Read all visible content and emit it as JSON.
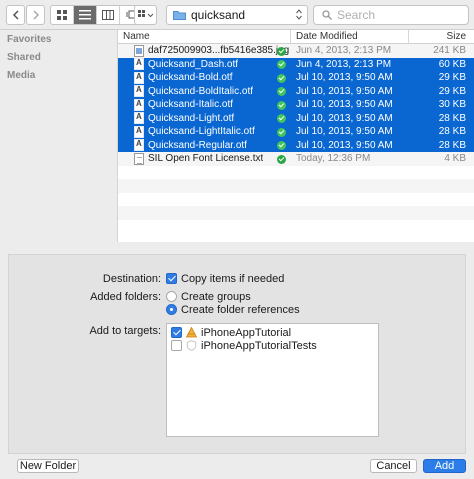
{
  "toolbar": {
    "back_icon": "chevron-left-icon",
    "forward_icon": "chevron-right-icon",
    "view_modes": [
      "icon-view",
      "list-view",
      "column-view",
      "coverflow-view"
    ],
    "arrange_icon": "arrange-grid-icon",
    "path_folder": "quicksand",
    "search_placeholder": "Search"
  },
  "sidebar": {
    "sections": [
      "Favorites",
      "Shared",
      "Media"
    ]
  },
  "file_list": {
    "columns": {
      "name": "Name",
      "date": "Date Modified",
      "size": "Size"
    },
    "rows": [
      {
        "name": "daf725009903...fb5416e385.jpg",
        "date": "Jun 4, 2013, 2:13 PM",
        "size": "241 KB",
        "selected": false,
        "icon": "image-file-icon",
        "checked": true
      },
      {
        "name": "Quicksand_Dash.otf",
        "date": "Jun 4, 2013, 2:13 PM",
        "size": "60 KB",
        "selected": true,
        "icon": "font-file-icon",
        "checked": true
      },
      {
        "name": "Quicksand-Bold.otf",
        "date": "Jul 10, 2013, 9:50 AM",
        "size": "29 KB",
        "selected": true,
        "icon": "font-file-icon",
        "checked": true
      },
      {
        "name": "Quicksand-BoldItalic.otf",
        "date": "Jul 10, 2013, 9:50 AM",
        "size": "29 KB",
        "selected": true,
        "icon": "font-file-icon",
        "checked": true
      },
      {
        "name": "Quicksand-Italic.otf",
        "date": "Jul 10, 2013, 9:50 AM",
        "size": "30 KB",
        "selected": true,
        "icon": "font-file-icon",
        "checked": true
      },
      {
        "name": "Quicksand-Light.otf",
        "date": "Jul 10, 2013, 9:50 AM",
        "size": "28 KB",
        "selected": true,
        "icon": "font-file-icon",
        "checked": true
      },
      {
        "name": "Quicksand-LightItalic.otf",
        "date": "Jul 10, 2013, 9:50 AM",
        "size": "28 KB",
        "selected": true,
        "icon": "font-file-icon",
        "checked": true
      },
      {
        "name": "Quicksand-Regular.otf",
        "date": "Jul 10, 2013, 9:50 AM",
        "size": "28 KB",
        "selected": true,
        "icon": "font-file-icon",
        "checked": true
      },
      {
        "name": "SIL Open Font License.txt",
        "date": "Today, 12:36 PM",
        "size": "4 KB",
        "selected": false,
        "icon": "text-file-icon",
        "checked": true
      }
    ]
  },
  "options": {
    "destination_label": "Destination:",
    "copy_items_label": "Copy items if needed",
    "copy_items_checked": true,
    "added_folders_label": "Added folders:",
    "create_groups_label": "Create groups",
    "create_folder_refs_label": "Create folder references",
    "selected_folder_option": "create_folder_references",
    "add_to_targets_label": "Add to targets:",
    "targets": [
      {
        "name": "iPhoneAppTutorial",
        "checked": true,
        "icon": "app-target-icon"
      },
      {
        "name": "iPhoneAppTutorialTests",
        "checked": false,
        "icon": "test-target-icon"
      }
    ]
  },
  "buttons": {
    "new_folder": "New Folder",
    "cancel": "Cancel",
    "add": "Add"
  },
  "colors": {
    "selection": "#0a67d2",
    "accent": "#2b7de9",
    "check_green": "#2aa744"
  }
}
